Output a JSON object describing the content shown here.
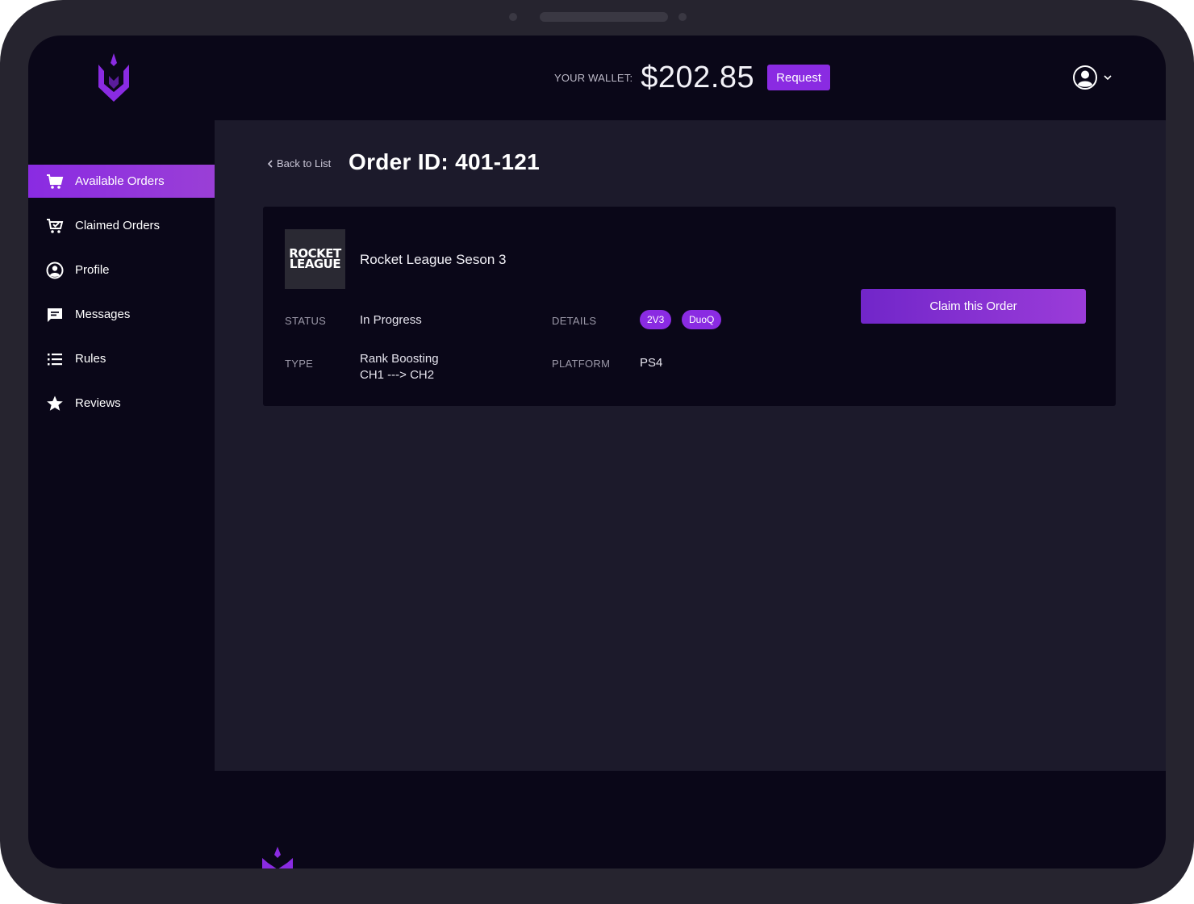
{
  "header": {
    "wallet_label": "YOUR WALLET:",
    "wallet_amount": "$202.85",
    "request_label": "Request"
  },
  "sidebar": {
    "items": [
      {
        "label": "Available Orders",
        "icon": "cart-icon",
        "active": true
      },
      {
        "label": "Claimed Orders",
        "icon": "cart-check-icon",
        "active": false
      },
      {
        "label": "Profile",
        "icon": "user-circle-icon",
        "active": false
      },
      {
        "label": "Messages",
        "icon": "message-icon",
        "active": false
      },
      {
        "label": "Rules",
        "icon": "list-icon",
        "active": false
      },
      {
        "label": "Reviews",
        "icon": "star-icon",
        "active": false
      }
    ]
  },
  "main": {
    "back_label": "Back to List",
    "title": "Order ID: 401-121"
  },
  "order": {
    "game_logo_line1": "ROCKET",
    "game_logo_line2": "LEAGUE",
    "game_name": "Rocket League Seson 3",
    "status_label": "STATUS",
    "status_value": "In Progress",
    "details_label": "DETAILS",
    "tags": [
      "2V3",
      "DuoQ"
    ],
    "type_label": "TYPE",
    "type_line1": "Rank Boosting",
    "type_line2": "CH1 ---> CH2",
    "platform_label": "PLATFORM",
    "platform_value": "PS4",
    "claim_label": "Claim this Order"
  },
  "colors": {
    "accent": "#8a2be2",
    "background": "#0a0718",
    "panel": "#1c1a2b",
    "device_frame": "#26242f"
  }
}
